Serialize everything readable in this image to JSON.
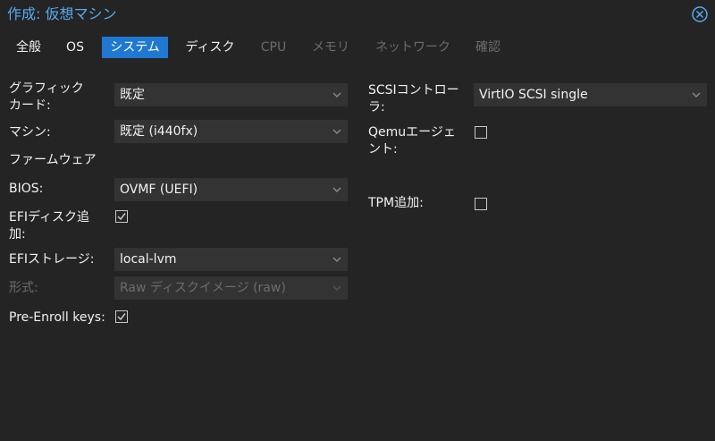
{
  "window": {
    "title": "作成: 仮想マシン",
    "close_icon": "close-circle-icon"
  },
  "colors": {
    "accent": "#1f78d1",
    "title_color": "#59a9f2",
    "background": "#242424",
    "field_bg": "#333333",
    "disabled_text": "#6c6c6c"
  },
  "tabs": [
    {
      "label": "全般",
      "state": "normal"
    },
    {
      "label": "OS",
      "state": "normal"
    },
    {
      "label": "システム",
      "state": "active"
    },
    {
      "label": "ディスク",
      "state": "normal"
    },
    {
      "label": "CPU",
      "state": "disabled"
    },
    {
      "label": "メモリ",
      "state": "disabled"
    },
    {
      "label": "ネットワーク",
      "state": "disabled"
    },
    {
      "label": "確認",
      "state": "disabled"
    }
  ],
  "left": {
    "graphics_label_1": "グラフィック",
    "graphics_label_2": "カード:",
    "graphics_value": "既定",
    "machine_label": "マシン:",
    "machine_value": "既定 (i440fx)",
    "firmware_heading": "ファームウェア",
    "bios_label": "BIOS:",
    "bios_value": "OVMF (UEFI)",
    "efidisk_label_1": "EFIディスク追",
    "efidisk_label_2": "加:",
    "efidisk_checked": true,
    "efistorage_label": "EFIストレージ:",
    "efistorage_value": "local-lvm",
    "format_label": "形式:",
    "format_value": "Raw ディスクイメージ (raw)",
    "preenroll_label": "Pre-Enroll keys:",
    "preenroll_checked": true
  },
  "right": {
    "scsi_label_1": "SCSIコントロー",
    "scsi_label_2": "ラ:",
    "scsi_value": "VirtIO SCSI single",
    "qemu_label_1": "Qemuエージェ",
    "qemu_label_2": "ント:",
    "qemu_checked": false,
    "tpm_label": "TPM追加:",
    "tpm_checked": false
  }
}
